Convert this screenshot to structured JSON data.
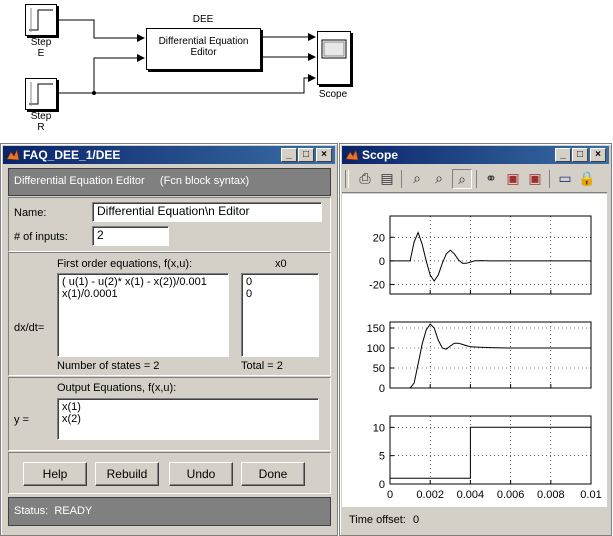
{
  "diagram": {
    "step_e_label": "Step\nE",
    "step_r_label": "Step\nR",
    "dee_title": "DEE",
    "dee_block_text": "Differential Equation\nEditor",
    "scope_label": "Scope"
  },
  "dee_window": {
    "title": "FAQ_DEE_1/DEE",
    "header": "Differential Equation Editor     (Fcn block syntax)",
    "name_label": "Name:",
    "name_value": "Differential Equation\\n Editor",
    "inputs_label": "# of inputs:",
    "inputs_value": "2",
    "first_order_label": "First order equations, f(x,u):",
    "x0_label": "x0",
    "dxdt_label": "dx/dt=",
    "equations": [
      "( u(1) - u(2)* x(1) - x(2))/0.001",
      "x(1)/0.0001"
    ],
    "x0_values": [
      "0",
      "0"
    ],
    "num_states": "Number of states = 2",
    "total": "Total = 2",
    "output_label": "Output Equations, f(x,u):",
    "y_label": "y =",
    "outputs": [
      "x(1)",
      "x(2)"
    ],
    "buttons": {
      "help": "Help",
      "rebuild": "Rebuild",
      "undo": "Undo",
      "done": "Done"
    },
    "status": "Status:  READY"
  },
  "scope_window": {
    "title": "Scope",
    "toolbar_icons": [
      "print-icon",
      "params-icon",
      "zoom-icon",
      "zoom-x-icon",
      "zoom-y-icon",
      "binoculars-icon",
      "save-axes-icon",
      "restore-axes-icon",
      "float-icon",
      "lock-icon"
    ],
    "time_offset_label": "Time offset:",
    "time_offset_value": "0"
  },
  "chart_data": [
    {
      "type": "line",
      "xlim": [
        0,
        0.01
      ],
      "ylim": [
        -28,
        38
      ],
      "yticks": [
        "20",
        "0",
        "-20"
      ],
      "ytick_values": [
        20,
        0,
        -20
      ],
      "x": [
        0,
        0.001,
        0.0012,
        0.0014,
        0.0016,
        0.0018,
        0.002,
        0.0022,
        0.0024,
        0.0026,
        0.0028,
        0.003,
        0.0032,
        0.0034,
        0.0036,
        0.0038,
        0.004,
        0.0042,
        0.0045,
        0.005,
        0.01
      ],
      "y": [
        0,
        0,
        16,
        24,
        14,
        0,
        -12,
        -17,
        -12,
        -2,
        6,
        9,
        6,
        1,
        -2,
        -2,
        -1,
        0,
        0.3,
        0,
        0
      ]
    },
    {
      "type": "line",
      "xlim": [
        0,
        0.01
      ],
      "ylim": [
        0,
        165
      ],
      "yticks": [
        "150",
        "100",
        "50",
        "0"
      ],
      "ytick_values": [
        150,
        100,
        50,
        0
      ],
      "x": [
        0,
        0.001,
        0.0012,
        0.0014,
        0.0016,
        0.0018,
        0.002,
        0.0022,
        0.0024,
        0.0026,
        0.0028,
        0.003,
        0.0032,
        0.0034,
        0.0036,
        0.0038,
        0.004,
        0.0045,
        0.005,
        0.006,
        0.01
      ],
      "y": [
        0,
        0,
        12,
        60,
        110,
        145,
        160,
        150,
        120,
        100,
        97,
        105,
        112,
        112,
        109,
        106,
        103,
        102,
        101,
        100,
        100
      ]
    },
    {
      "type": "line",
      "xlim": [
        0,
        0.01
      ],
      "ylim": [
        0,
        12
      ],
      "yticks": [
        "10",
        "5",
        "0"
      ],
      "ytick_values": [
        10,
        5,
        0
      ],
      "xticks": [
        "0",
        "0.002",
        "0.004",
        "0.006",
        "0.008",
        "0.01"
      ],
      "xtick_values": [
        0,
        0.002,
        0.004,
        0.006,
        0.008,
        0.01
      ],
      "x": [
        0,
        0.004,
        0.004,
        0.01
      ],
      "y": [
        1,
        1,
        10,
        10
      ]
    }
  ]
}
